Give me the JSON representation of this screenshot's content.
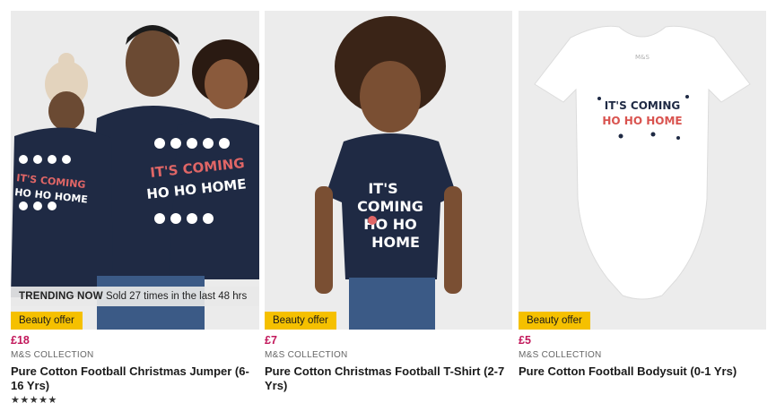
{
  "products": [
    {
      "trending_label": "TRENDING NOW",
      "trending_text": "Sold 27 times in the last 48 hrs",
      "offer": "Beauty offer",
      "price": "£18",
      "brand": "M&S COLLECTION",
      "title": "Pure Cotton Football Christmas Jumper (6-16 Yrs)",
      "rating": 5,
      "rating_max": 5,
      "stars": "★★★★★"
    },
    {
      "offer": "Beauty offer",
      "price": "£7",
      "brand": "M&S COLLECTION",
      "title": "Pure Cotton Christmas Football T-Shirt (2-7 Yrs)"
    },
    {
      "offer": "Beauty offer",
      "price": "£5",
      "brand": "M&S COLLECTION",
      "title": "Pure Cotton Football Bodysuit (0-1 Yrs)"
    }
  ],
  "image_text": {
    "jumper_line1": "IT'S COMING",
    "jumper_line2": "HO HO HOME",
    "tshirt_line1": "IT'S",
    "tshirt_line2": "COMING",
    "tshirt_line3": "HO HO",
    "tshirt_line4": "HOME",
    "bodysuit_line1": "IT'S COMING",
    "bodysuit_line2": "HO HO HOME",
    "bodysuit_label": "M&S"
  },
  "colors": {
    "price": "#c2185b",
    "offer_badge": "#f5c000",
    "navy_garment": "#1f2a44",
    "print_red": "#d9534f"
  }
}
